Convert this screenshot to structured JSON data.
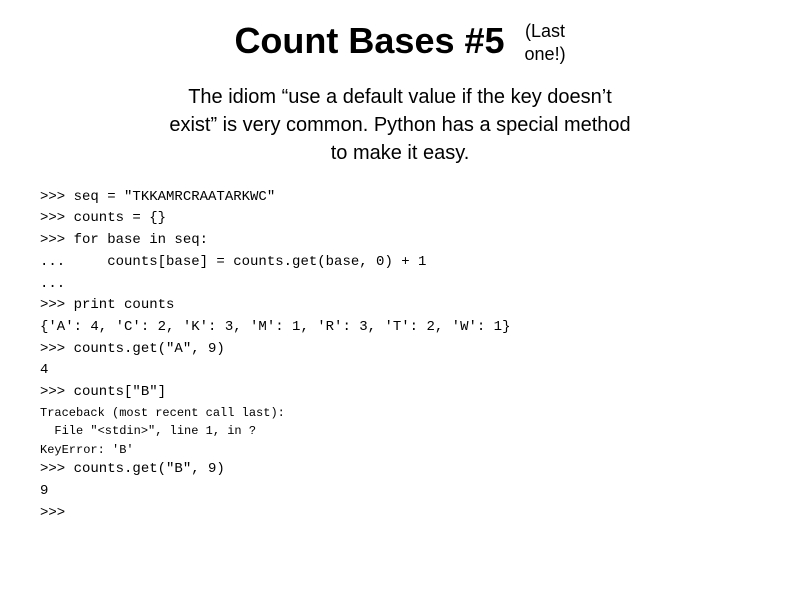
{
  "header": {
    "title": "Count Bases #5",
    "last_one_line1": "(Last",
    "last_one_line2": "one!)"
  },
  "subtitle": {
    "line1": "The idiom “use a default value if the key doesn’t",
    "line2": "exist” is very common.  Python has a special method",
    "line3": "to make it easy."
  },
  "code": {
    "lines": [
      ">>> seq = \"TKKAMRCRAATARKWC\"",
      ">>> counts = {}",
      ">>> for base in seq:",
      "...     counts[base] = counts.get(base, 0) + 1",
      "...",
      ">>> print counts",
      "{'A': 4, 'C': 2, 'K': 3, 'M': 1, 'R': 3, 'T': 2, 'W': 1}",
      ">>> counts.get(\"A\", 9)",
      "4",
      ">>> counts[\"B\"]",
      "Traceback (most recent call last):",
      "  File \"<stdin>\", line 1, in ?",
      "KeyError: 'B'",
      ">>> counts.get(\"B\", 9)",
      "9",
      ">>>"
    ]
  }
}
